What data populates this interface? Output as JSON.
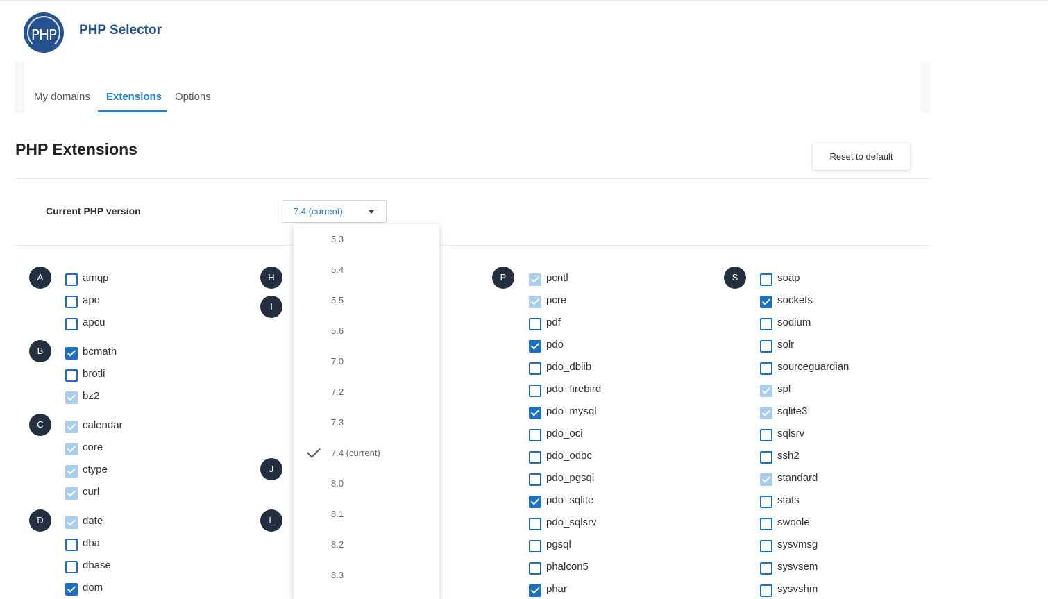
{
  "app": {
    "title": "PHP Selector",
    "logo_text": "PHP"
  },
  "tabs": [
    {
      "label": "My domains"
    },
    {
      "label": "Extensions",
      "active": true
    },
    {
      "label": "Options"
    }
  ],
  "page": {
    "title": "PHP Extensions",
    "reset_label": "Reset to default"
  },
  "version": {
    "label": "Current PHP version",
    "selected": "7.4 (current)"
  },
  "dropdown": {
    "options": [
      "5.3",
      "5.4",
      "5.5",
      "5.6",
      "7.0",
      "7.2",
      "7.3",
      "7.4 (current)",
      "8.0",
      "8.1",
      "8.2",
      "8.3"
    ],
    "selected": "7.4 (current)"
  },
  "letters": [
    "A",
    "B",
    "C",
    "D",
    "H",
    "I",
    "J",
    "L",
    "P",
    "S"
  ],
  "extensions": {
    "col1": [
      {
        "name": "amqp",
        "state": "off"
      },
      {
        "name": "apc",
        "state": "off"
      },
      {
        "name": "apcu",
        "state": "off"
      },
      {
        "name": "bcmath",
        "state": "on"
      },
      {
        "name": "brotli",
        "state": "off"
      },
      {
        "name": "bz2",
        "state": "disabled"
      },
      {
        "name": "calendar",
        "state": "disabled"
      },
      {
        "name": "core",
        "state": "disabled"
      },
      {
        "name": "ctype",
        "state": "disabled"
      },
      {
        "name": "curl",
        "state": "disabled"
      },
      {
        "name": "date",
        "state": "disabled"
      },
      {
        "name": "dba",
        "state": "off"
      },
      {
        "name": "dbase",
        "state": "off"
      },
      {
        "name": "dom",
        "state": "on"
      }
    ],
    "col3": [
      {
        "name": "pcntl",
        "state": "disabled"
      },
      {
        "name": "pcre",
        "state": "disabled"
      },
      {
        "name": "pdf",
        "state": "off"
      },
      {
        "name": "pdo",
        "state": "on"
      },
      {
        "name": "pdo_dblib",
        "state": "off"
      },
      {
        "name": "pdo_firebird",
        "state": "off"
      },
      {
        "name": "pdo_mysql",
        "state": "on"
      },
      {
        "name": "pdo_oci",
        "state": "off"
      },
      {
        "name": "pdo_odbc",
        "state": "off"
      },
      {
        "name": "pdo_pgsql",
        "state": "off"
      },
      {
        "name": "pdo_sqlite",
        "state": "on"
      },
      {
        "name": "pdo_sqlsrv",
        "state": "off"
      },
      {
        "name": "pgsql",
        "state": "off"
      },
      {
        "name": "phalcon5",
        "state": "off"
      },
      {
        "name": "phar",
        "state": "on"
      }
    ],
    "col4": [
      {
        "name": "soap",
        "state": "off"
      },
      {
        "name": "sockets",
        "state": "on"
      },
      {
        "name": "sodium",
        "state": "off"
      },
      {
        "name": "solr",
        "state": "off"
      },
      {
        "name": "sourceguardian",
        "state": "off"
      },
      {
        "name": "spl",
        "state": "disabled"
      },
      {
        "name": "sqlite3",
        "state": "disabled"
      },
      {
        "name": "sqlsrv",
        "state": "off"
      },
      {
        "name": "ssh2",
        "state": "off"
      },
      {
        "name": "standard",
        "state": "disabled"
      },
      {
        "name": "stats",
        "state": "off"
      },
      {
        "name": "swoole",
        "state": "off"
      },
      {
        "name": "sysvmsg",
        "state": "off"
      },
      {
        "name": "sysvsem",
        "state": "off"
      },
      {
        "name": "sysvshm",
        "state": "off"
      }
    ]
  },
  "colors": {
    "brand": "#25528f",
    "accent": "#1f7fc8",
    "checkbox": "#1e6fbf",
    "checkbox_disabled": "#a9cdef",
    "letter_badge": "#24303f"
  }
}
